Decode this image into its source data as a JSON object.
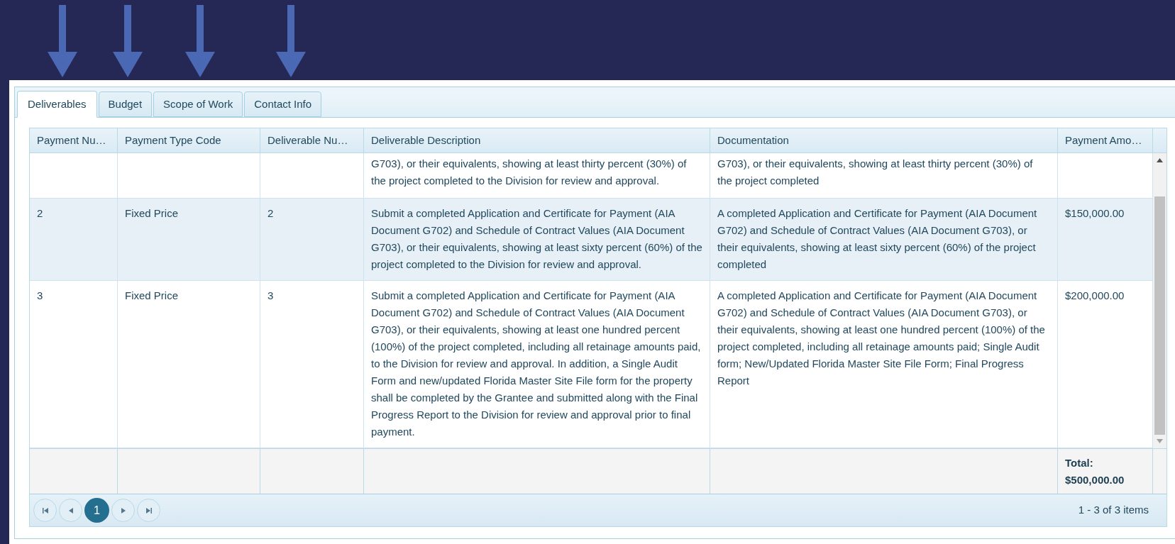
{
  "tabs": [
    {
      "label": "Deliverables",
      "selected": true
    },
    {
      "label": "Budget",
      "selected": false
    },
    {
      "label": "Scope of Work",
      "selected": false
    },
    {
      "label": "Contact Info",
      "selected": false
    }
  ],
  "table": {
    "columns": [
      "Payment Nu…",
      "Payment Type Code",
      "Deliverable Nu…",
      "Deliverable Description",
      "Documentation",
      "Payment Amo…"
    ],
    "rows": [
      {
        "description": "G703), or their equivalents, showing at least thirty percent (30%) of the project completed to the Division for review and approval.",
        "documentation": "G703), or their equivalents, showing at least thirty percent (30%) of the project completed"
      },
      {
        "payment_number": "2",
        "payment_type_code": "Fixed Price",
        "deliverable_number": "2",
        "description": "Submit a completed Application and Certificate for Payment (AIA Document G702) and Schedule of Contract Values (AIA Document G703), or their equivalents, showing at least sixty percent (60%) of the project completed to the Division for review and approval.",
        "documentation": "A completed Application and Certificate for Payment (AIA Document G702) and Schedule of Contract Values (AIA Document G703), or their equivalents, showing at least sixty percent (60%) of the project completed",
        "payment_amount": "$150,000.00"
      },
      {
        "payment_number": "3",
        "payment_type_code": "Fixed Price",
        "deliverable_number": "3",
        "description": "Submit a completed Application and Certificate for Payment (AIA Document G702) and Schedule of Contract Values (AIA Document G703), or their equivalents, showing at least one hundred percent (100%) of the project completed, including all retainage amounts paid, to the Division for review and approval. In addition, a Single Audit Form and new/updated Florida Master Site File form for the property shall be completed by the Grantee and submitted along with the Final Progress Report to the Division for review and approval prior to final payment.",
        "documentation": "A completed Application and Certificate for Payment (AIA Document G702) and Schedule of Contract Values (AIA Document G703), or their equivalents, showing at least one hundred percent (100%) of the project completed, including all retainage amounts paid; Single Audit form; New/Updated Florida Master Site File Form; Final Progress Report",
        "payment_amount": "$200,000.00"
      }
    ],
    "footer": {
      "total_label": "Total:",
      "total_value": "$500,000.00"
    }
  },
  "pager": {
    "pages": [
      {
        "label": "1",
        "selected": true
      }
    ],
    "info": "1 - 3 of 3 items"
  }
}
